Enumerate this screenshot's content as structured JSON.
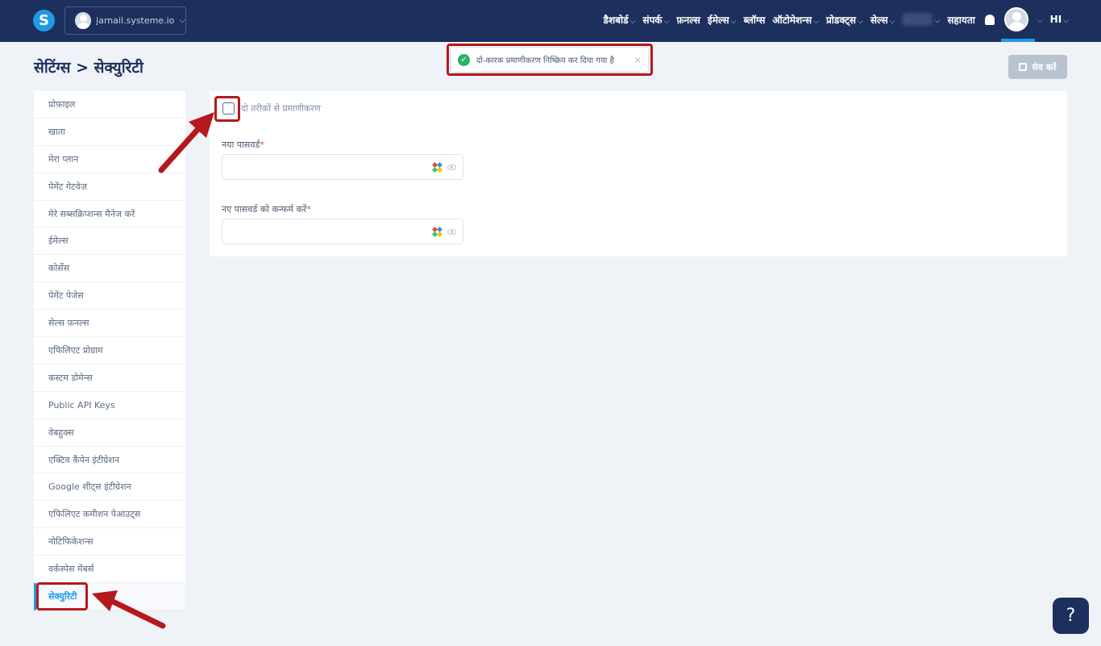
{
  "app": {
    "logo_letter": "S"
  },
  "workspace": {
    "name": "jarnail.systeme.io"
  },
  "nav": {
    "items": [
      {
        "label": "डैशबोर्ड",
        "chevron": true
      },
      {
        "label": "संपर्क",
        "chevron": true
      },
      {
        "label": "फ़नल्स",
        "chevron": false
      },
      {
        "label": "ईमेल्स",
        "chevron": true
      },
      {
        "label": "ब्लॉग्स",
        "chevron": false
      },
      {
        "label": "ऑटोमेशन्स",
        "chevron": true
      },
      {
        "label": "प्रोडक्ट्स",
        "chevron": true
      },
      {
        "label": "सेल्स",
        "chevron": true
      }
    ],
    "help_label": "सहायता",
    "language_label": "HI"
  },
  "header": {
    "breadcrumb": "सेटिंग्स > सेक्युरिटी",
    "save_label": "सेव करें"
  },
  "toast": {
    "message": "दो-कारक प्रमाणीकरण निष्क्रिय कर दिया गया है",
    "close": "×"
  },
  "sidebar": {
    "items": [
      "प्रोफ़ाइल",
      "खाता",
      "मेरा प्लान",
      "पेमेंट गेटवेज़",
      "मेरे सब्सक्रिप्शन्स मैनेज करें",
      "ईमेल्स",
      "कोर्सेस",
      "पेमेंट पेजेस",
      "सेल्स फ़नल्स",
      "एफिलिएट प्रोग्राम",
      "कस्टम डोमेन्स",
      "Public API Keys",
      "वेबहुक्स",
      "एक्टिव कैंपेन इंटीग्रेशन",
      "Google शीट्स इंटीग्रेशन",
      "एफिलिएट कमीशन पेआउट्स",
      "नोटिफिकेशन्स",
      "वर्कस्पेस मेंबर्स",
      "सेक्युरिटी"
    ],
    "active_index": 18
  },
  "security": {
    "two_factor_label": "दो तरीकों से प्रमाणीकरण",
    "two_factor_checked": false,
    "new_password_label": "नया पासवर्ड",
    "confirm_password_label": "नए पासवर्ड को कन्फर्म करें",
    "required_mark": "*"
  },
  "help_button": {
    "label": "?"
  },
  "colors": {
    "topbar": "#1d2f5c",
    "accent": "#1f9ae6",
    "annotation": "#b5191d",
    "success": "#2ab26a"
  }
}
